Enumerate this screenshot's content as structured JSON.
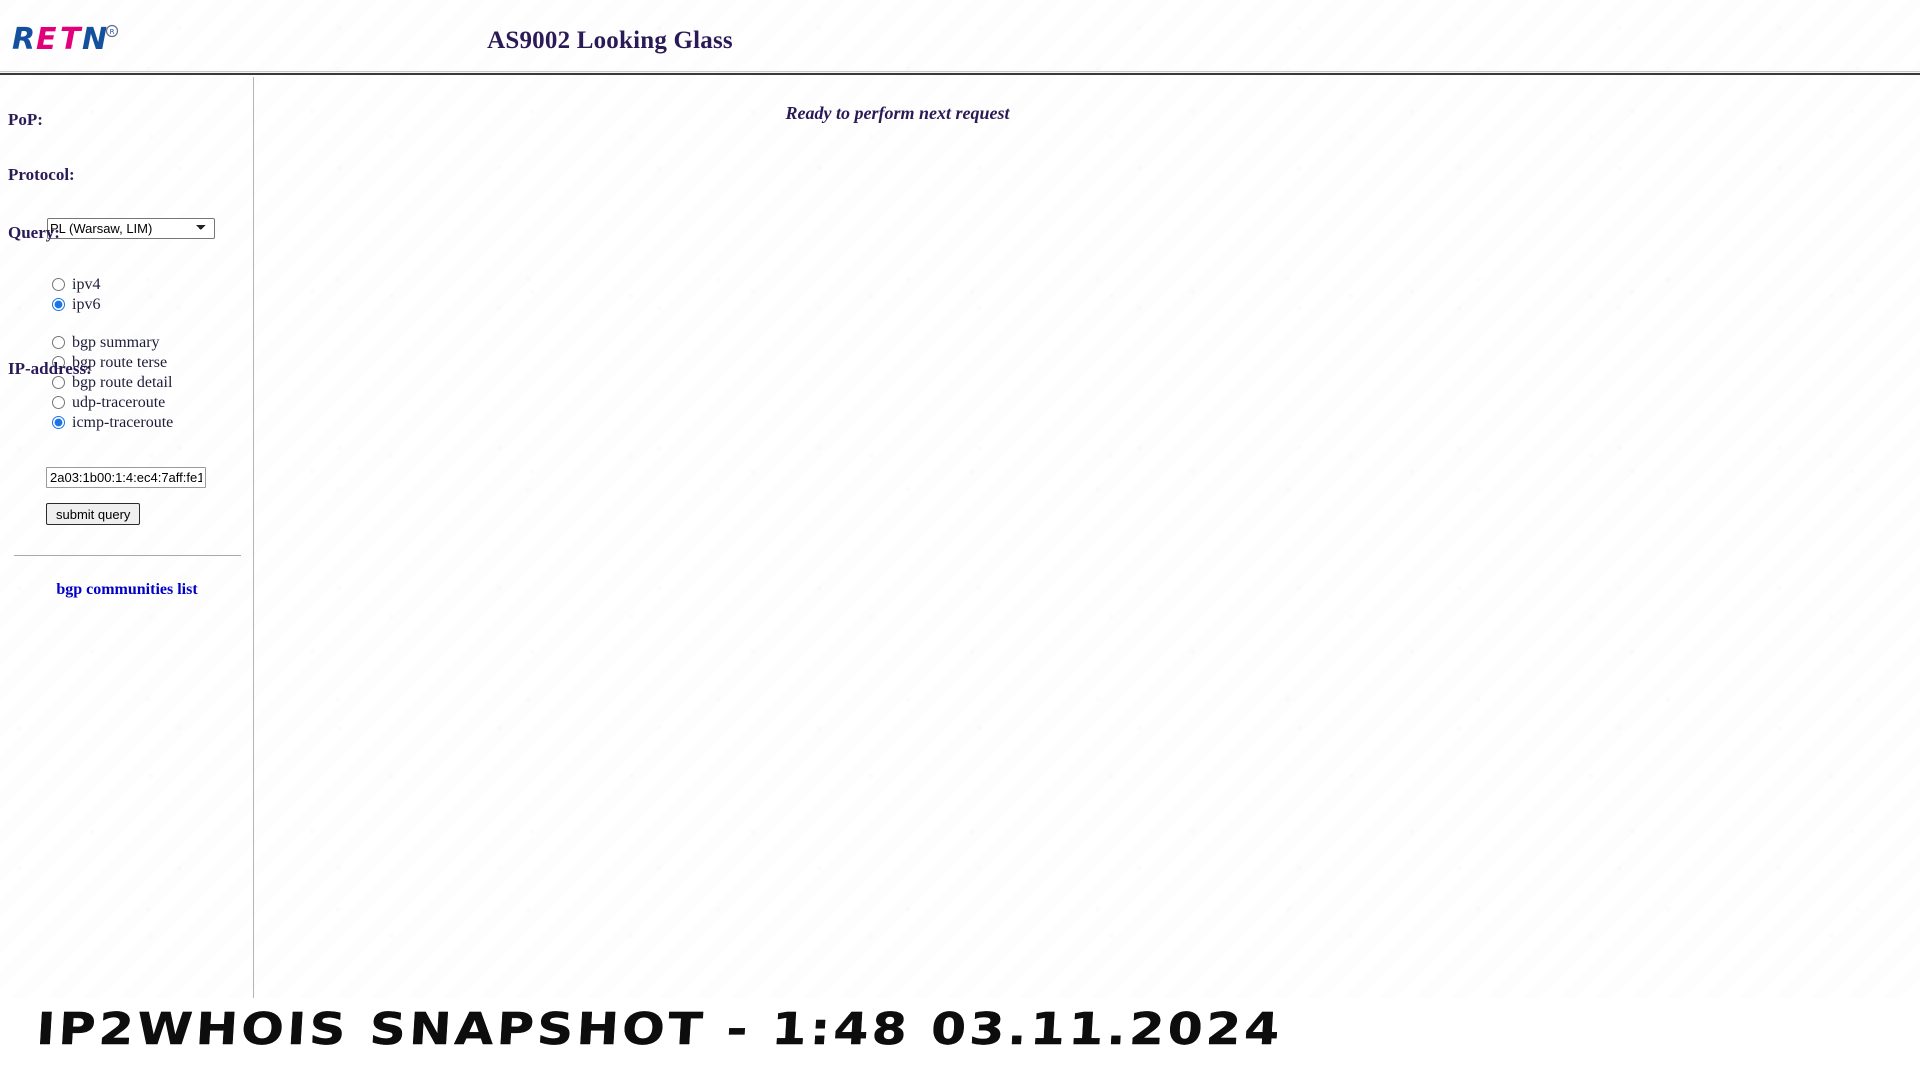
{
  "header": {
    "logo_text": "RETN",
    "logo_registered_mark": "®",
    "logo_colors": {
      "blue": "#15509e",
      "magenta": "#e2007a"
    },
    "title": "AS9002 Looking Glass",
    "title_color": "#2a1a56"
  },
  "sidebar": {
    "pop": {
      "label": "PoP:",
      "selected": "PL (Warsaw, LIM)",
      "options": [
        "PL (Warsaw, LIM)"
      ],
      "chevron_icon": "chevron-down-icon"
    },
    "protocol": {
      "label": "Protocol:",
      "options": [
        {
          "id": "ipv4",
          "label": "ipv4",
          "checked": false
        },
        {
          "id": "ipv6",
          "label": "ipv6",
          "checked": true
        }
      ]
    },
    "query": {
      "label": "Query:",
      "options": [
        {
          "id": "bgp-summary",
          "label": "bgp summary",
          "checked": false
        },
        {
          "id": "bgp-route-terse",
          "label": "bgp route terse",
          "checked": false
        },
        {
          "id": "bgp-route-detail",
          "label": "bgp route detail",
          "checked": false
        },
        {
          "id": "udp-traceroute",
          "label": "udp-traceroute",
          "checked": false
        },
        {
          "id": "icmp-traceroute",
          "label": "icmp-traceroute",
          "checked": true
        }
      ]
    },
    "ip_address": {
      "label": "IP-address:",
      "value": "2a03:1b00:1:4:ec4:7aff:fe1",
      "placeholder": ""
    },
    "submit_label": "submit query",
    "communities_link": {
      "label": "bgp communities list",
      "color": "#0000c8"
    }
  },
  "content": {
    "status_message": "Ready to perform next request"
  },
  "footer": {
    "watermark": "IP2WHOIS SNAPSHOT - 1:48 03.11.2024"
  }
}
